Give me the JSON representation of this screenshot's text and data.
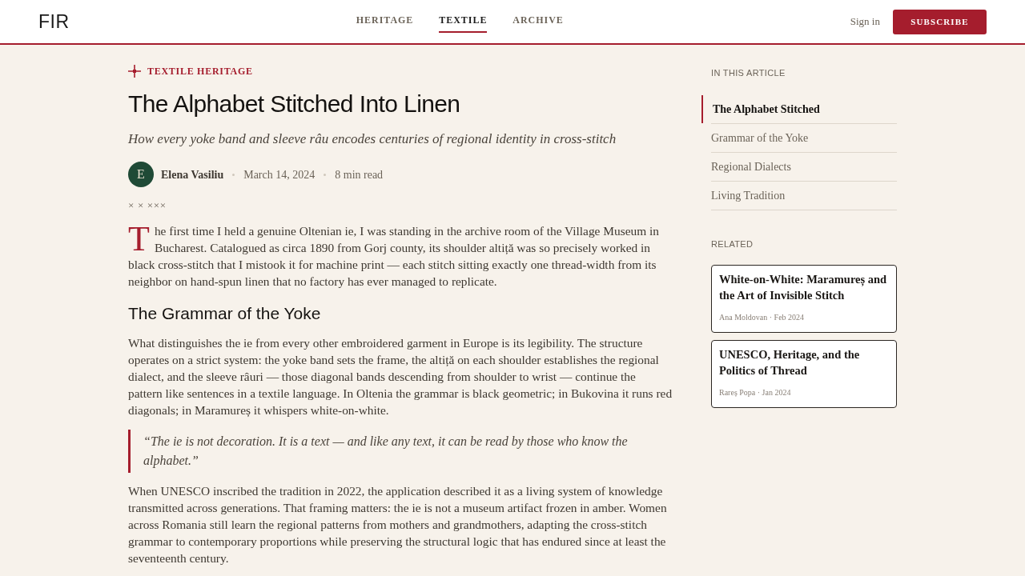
{
  "header": {
    "logo": "FIR",
    "nav": [
      {
        "label": "HERITAGE",
        "selected": false
      },
      {
        "label": "TEXTILE",
        "selected": true
      },
      {
        "label": "ARCHIVE",
        "selected": false
      }
    ],
    "sign_in": "Sign in",
    "subscribe": "SUBSCRIBE"
  },
  "article": {
    "category": "TEXTILE HERITAGE",
    "title": "The Alphabet Stitched Into Linen",
    "subtitle": "How every yoke band and sleeve râu encodes centuries of regional identity in cross-stitch",
    "author": {
      "initial": "E",
      "name": "Elena Vasiliu"
    },
    "date": "March 14, 2024",
    "read_time": "8 min read",
    "ornament": "× × ×××",
    "body": [
      {
        "kind": "paragraph",
        "drop_cap": "T",
        "text": "he first time I held a genuine Oltenian ie, I was standing in the archive room of the Village Museum in Bucharest. Catalogued as circa 1890 from Gorj county, its shoulder altiță was so precisely worked in black cross-stitch that I mistook it for machine print — each stitch sitting exactly one thread-width from its neighbor on hand-spun linen that no factory has ever managed to replicate."
      },
      {
        "kind": "heading",
        "text": "The Grammar of the Yoke"
      },
      {
        "kind": "paragraph",
        "text": "What distinguishes the ie from every other embroidered garment in Europe is its legibility. The structure operates on a strict system: the yoke band sets the frame, the altiță on each shoulder establishes the regional dialect, and the sleeve râuri — those diagonal bands descending from shoulder to wrist — continue the pattern like sentences in a textile language. In Oltenia the grammar is black geometric; in Bukovina it runs red diagonals; in Maramureș it whispers white-on-white."
      },
      {
        "kind": "quote",
        "text": "“The ie is not decoration. It is a text — and like any text, it can be read by those who know the alphabet.”"
      },
      {
        "kind": "paragraph",
        "text": "When UNESCO inscribed the tradition in 2022, the application described it as a living system of knowledge transmitted across generations. That framing matters: the ie is not a museum artifact frozen in amber. Women across Romania still learn the regional patterns from mothers and grandmothers, adapting the cross-stitch grammar to contemporary proportions while preserving the structural logic that has endured since at least the seventeenth century."
      }
    ]
  },
  "sidebar": {
    "toc_title": "IN THIS ARTICLE",
    "toc": [
      {
        "label": "The Alphabet Stitched",
        "selected": true
      },
      {
        "label": "Grammar of the Yoke",
        "selected": false
      },
      {
        "label": "Regional Dialects",
        "selected": false
      },
      {
        "label": "Living Tradition",
        "selected": false
      }
    ],
    "related_title": "RELATED",
    "related": [
      {
        "title": "White-on-White: Maramureș and the Art of Invisible Stitch",
        "meta": "Ana Moldovan · Feb 2024"
      },
      {
        "title": "UNESCO, Heritage, and the Politics of Thread",
        "meta": "Rareș Popa · Jan 2024"
      }
    ]
  }
}
